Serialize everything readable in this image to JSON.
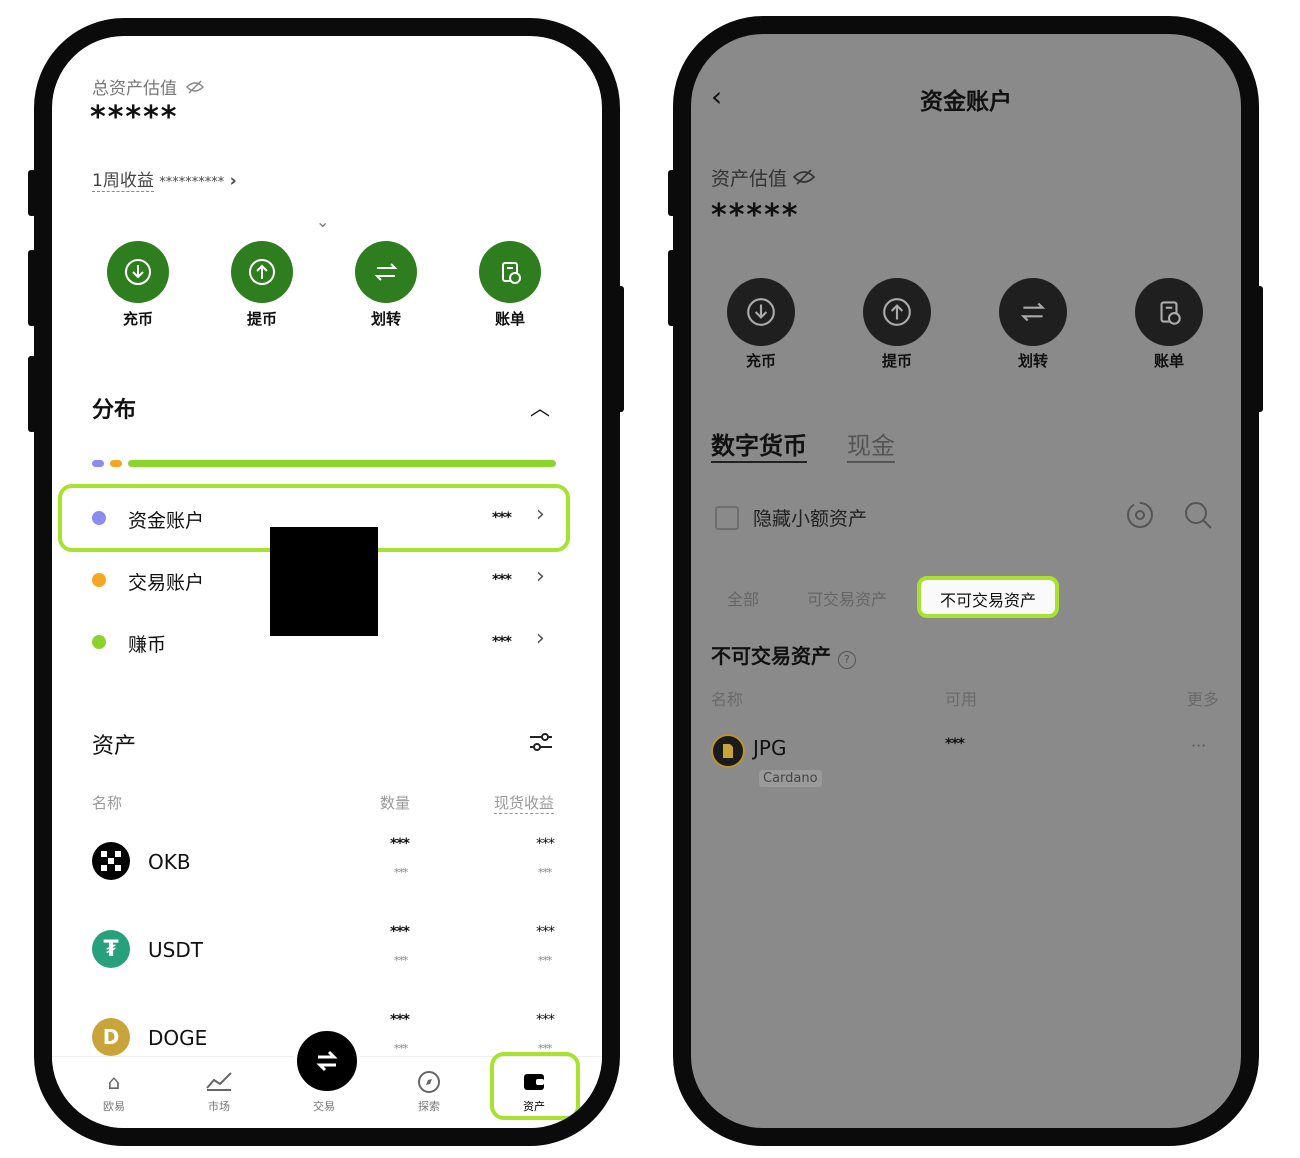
{
  "left": {
    "total_label": "总资产估值",
    "total_value": "*****",
    "weekly_label": "1周收益",
    "weekly_value": "**********",
    "actions": [
      {
        "label": "充币",
        "icon": "deposit-icon"
      },
      {
        "label": "提币",
        "icon": "withdraw-icon"
      },
      {
        "label": "划转",
        "icon": "transfer-icon"
      },
      {
        "label": "账单",
        "icon": "bill-icon"
      }
    ],
    "distribution_title": "分布",
    "accounts": [
      {
        "name": "资金账户",
        "value": "***",
        "color": "#8b8bf0"
      },
      {
        "name": "交易账户",
        "value": "***",
        "color": "#f5a623"
      },
      {
        "name": "赚币",
        "value": "***",
        "color": "#8bd42b"
      }
    ],
    "assets_title": "资产",
    "columns": {
      "name": "名称",
      "qty": "数量",
      "pnl": "现货收益"
    },
    "assets": [
      {
        "symbol": "OKB",
        "qty": "***",
        "qty_sub": "***",
        "pnl": "***",
        "pnl_sub": "***"
      },
      {
        "symbol": "USDT",
        "qty": "***",
        "qty_sub": "***",
        "pnl": "***",
        "pnl_sub": "***"
      },
      {
        "symbol": "DOGE",
        "qty": "***",
        "qty_sub": "***",
        "pnl": "***",
        "pnl_sub": "***"
      }
    ],
    "nav": [
      {
        "label": "欧易",
        "icon": "home-icon"
      },
      {
        "label": "市场",
        "icon": "market-icon"
      },
      {
        "label": "交易",
        "icon": "swap-icon"
      },
      {
        "label": "探索",
        "icon": "compass-icon"
      },
      {
        "label": "资产",
        "icon": "wallet-icon"
      }
    ]
  },
  "right": {
    "title": "资金账户",
    "total_label": "资产估值",
    "total_value": "*****",
    "actions": [
      {
        "label": "充币",
        "icon": "deposit-icon"
      },
      {
        "label": "提币",
        "icon": "withdraw-icon"
      },
      {
        "label": "划转",
        "icon": "transfer-icon"
      },
      {
        "label": "账单",
        "icon": "bill-icon"
      }
    ],
    "tabs": [
      "数字货币",
      "现金"
    ],
    "hide_small_label": "隐藏小额资产",
    "filters": [
      "全部",
      "可交易资产",
      "不可交易资产"
    ],
    "section_title": "不可交易资产",
    "columns": {
      "name": "名称",
      "avail": "可用",
      "more": "更多"
    },
    "asset": {
      "symbol": "JPG",
      "chain": "Cardano",
      "avail": "***",
      "more": "···"
    }
  },
  "colors": {
    "accent_green": "#2e7d1e",
    "highlight": "#a6e22e",
    "overlay_gray": "#8a8a8a"
  }
}
